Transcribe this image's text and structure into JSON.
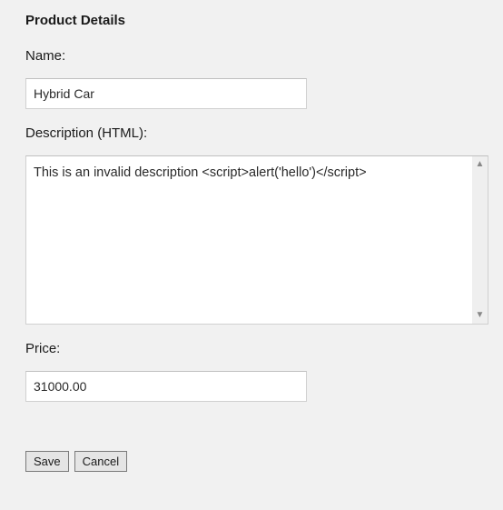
{
  "section": {
    "title": "Product Details"
  },
  "fields": {
    "name": {
      "label": "Name:",
      "value": "Hybrid Car"
    },
    "description": {
      "label": "Description (HTML):",
      "value": "This is an invalid description <script>alert('hello')</script>"
    },
    "price": {
      "label": "Price:",
      "value": "31000.00"
    }
  },
  "buttons": {
    "save": "Save",
    "cancel": "Cancel"
  }
}
